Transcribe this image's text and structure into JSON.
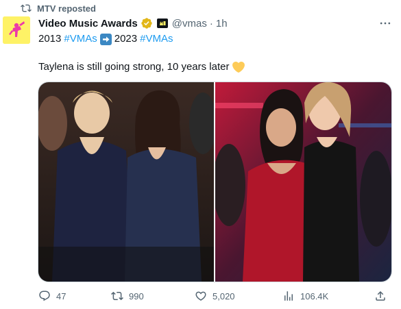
{
  "repost": {
    "label": "MTV reposted"
  },
  "author": {
    "name": "Video Music Awards",
    "handle": "@vmas",
    "separator": "·",
    "time": "1h"
  },
  "tweet": {
    "line1": {
      "year1": "2013",
      "tag1": "#VMAs",
      "year2": "2023",
      "tag2": "#VMAs"
    },
    "line2": {
      "text": "Taylena is still going strong, 10 years later",
      "emoji": "yellow-heart-icon"
    }
  },
  "media": {
    "photos": [
      {
        "name": "photo-2013",
        "description_icon": "photo-icon"
      },
      {
        "name": "photo-2023",
        "description_icon": "photo-icon"
      }
    ]
  },
  "actions": {
    "replies": "47",
    "reposts": "990",
    "likes": "5,020",
    "views": "106.4K"
  },
  "colors": {
    "accent": "#1d9bf0",
    "secondary_text": "#536471",
    "verified_gold": "#e2b719",
    "avatar_bg": "#fef266"
  }
}
